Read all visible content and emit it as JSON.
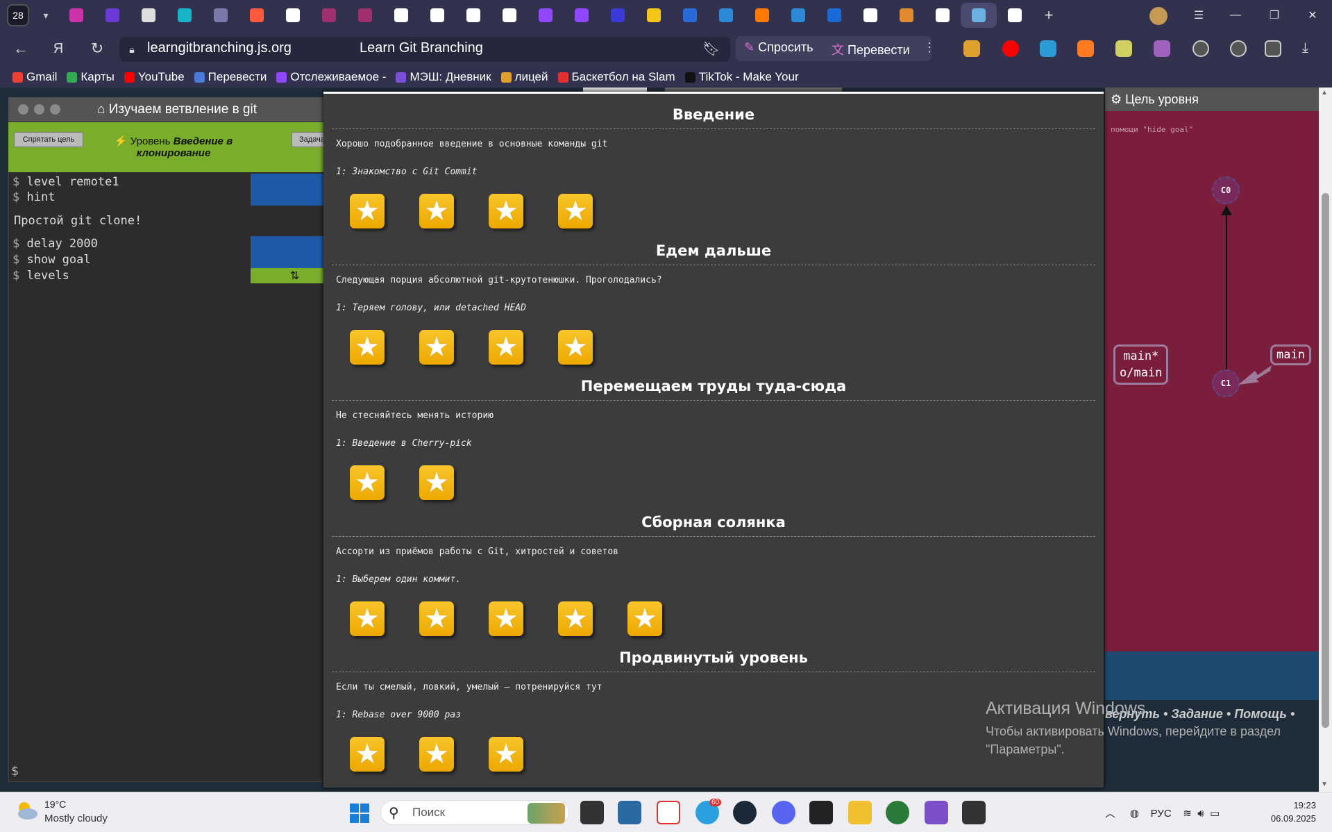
{
  "browser": {
    "tab_count": "28",
    "url": "learngitbranching.js.org",
    "title": "Learn Git Branching",
    "ask_label": "Спросить",
    "translate_label": "Перевести"
  },
  "bookmarks": [
    {
      "label": "Gmail",
      "color": "#ea4335"
    },
    {
      "label": "Карты",
      "color": "#34a853"
    },
    {
      "label": "YouTube",
      "color": "#ff0000"
    },
    {
      "label": "Перевести",
      "color": "#4a7bd8"
    },
    {
      "label": "Отслеживаемое -",
      "color": "#9146ff"
    },
    {
      "label": "МЭШ: Дневник",
      "color": "#7b4fd8"
    },
    {
      "label": "лицей",
      "color": "#e0a030"
    },
    {
      "label": "Баскетбол на Slam",
      "color": "#e03030"
    },
    {
      "label": "TikTok - Make Your",
      "color": "#111111"
    }
  ],
  "terminal": {
    "title": "⌂ Изучаем ветвление в git",
    "hide_goal": "Спрятать цель",
    "level_prefix": "⚡ Уровень ",
    "level_name": "Введение в клонирование",
    "task_button": "Задача",
    "lines": [
      {
        "cmd": "level remote1"
      },
      {
        "cmd": "hint"
      },
      {
        "text": "Простой git clone!"
      },
      {
        "cmd": "delay 2000"
      },
      {
        "cmd": "show goal"
      },
      {
        "cmd": "levels"
      }
    ],
    "prompt": "$"
  },
  "goal": {
    "title": "⚙ Цель уровня",
    "note": "помощи \"hide goal\"",
    "nodes": [
      {
        "label": "C0"
      },
      {
        "label": "C1"
      }
    ],
    "branches": [
      "main*\no/main",
      "main"
    ],
    "bottom_links": "вернуть • Задание • Помощь •"
  },
  "modal": {
    "sections": [
      {
        "title": "Введение",
        "desc": "Хорошо подобранное введение в основные команды git",
        "first": "1: Знакомство с Git Commit",
        "stars": 4
      },
      {
        "title": "Едем дальше",
        "desc": "Следующая порция абсолютной git-крутотенюшки. Проголодались?",
        "first": "1: Теряем голову, или detached HEAD",
        "stars": 4
      },
      {
        "title": "Перемещаем труды туда-сюда",
        "desc": "Не стесняйтесь менять историю",
        "first": "1: Введение в Cherry-pick",
        "stars": 2
      },
      {
        "title": "Сборная солянка",
        "desc": "Ассорти из приёмов работы с Git, хитростей и советов",
        "first": "1: Выберем один коммит.",
        "stars": 5
      },
      {
        "title": "Продвинутый уровень",
        "desc": "Если ты смелый, ловкий, умелый – потренируйся тут",
        "first": "1: Rebase over 9000 раз",
        "stars": 3
      }
    ]
  },
  "watermark": {
    "line1": "Активация Windows",
    "line2": "Чтобы активировать Windows, перейдите в раздел",
    "line3": "\"Параметры\"."
  },
  "taskbar": {
    "temperature": "19°C",
    "weather": "Mostly cloudy",
    "search_placeholder": "Поиск",
    "language": "РУС",
    "time": "19:23",
    "date": "06.09.2025",
    "telegram_badge": "60"
  }
}
